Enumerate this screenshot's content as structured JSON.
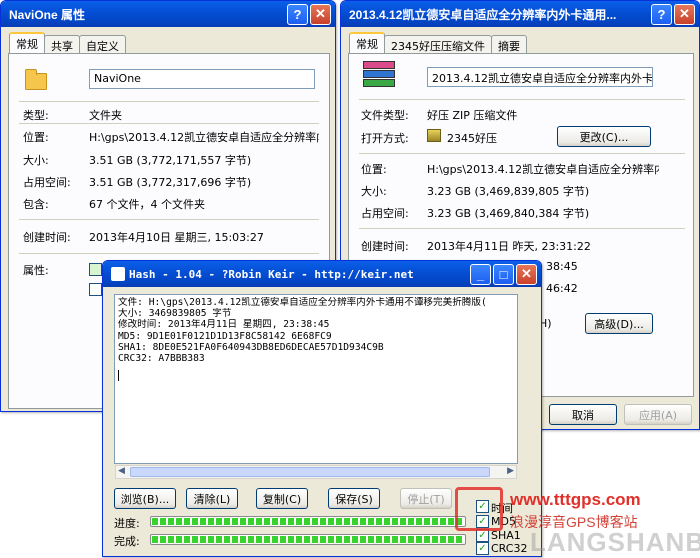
{
  "win1": {
    "title": "NaviOne 属性",
    "tabs": [
      "常规",
      "共享",
      "自定义"
    ],
    "name_value": "NaviOne",
    "rows": [
      {
        "label": "类型:",
        "value": "文件夹"
      },
      {
        "label": "位置:",
        "value": "H:\\gps\\2013.4.12凯立德安卓自适应全分辨率内"
      },
      {
        "label": "大小:",
        "value": "3.51 GB (3,772,171,557 字节)"
      },
      {
        "label": "占用空间:",
        "value": "3.51 GB (3,772,317,696 字节)"
      },
      {
        "label": "包含:",
        "value": "67 个文件，4 个文件夹"
      },
      {
        "label": "创建时间:",
        "value": "2013年4月10日 星期三, 15:03:27"
      },
      {
        "label": "属性:",
        "value": ""
      }
    ]
  },
  "win2": {
    "title": "2013.4.12凯立德安卓自适应全分辨率内外卡通用...",
    "tabs": [
      "常规",
      "2345好压压缩文件",
      "摘要"
    ],
    "name_value": "2013.4.12凯立德安卓自适应全分辨率内外卡通",
    "type_label": "文件类型:",
    "type_value": "好压 ZIP 压缩文件",
    "open_label": "打开方式:",
    "open_value": "2345好压",
    "change_button": "更改(C)...",
    "rows": [
      {
        "label": "位置:",
        "value": "H:\\gps\\2013.4.12凯立德安卓自适应全分辨率内"
      },
      {
        "label": "大小:",
        "value": "3.23 GB (3,469,839,805 字节)"
      },
      {
        "label": "占用空间:",
        "value": "3.23 GB (3,469,840,384 字节)"
      },
      {
        "label": "创建时间:",
        "value": "2013年4月11日 昨天, 23:31:22"
      }
    ],
    "partial1": "38:45",
    "partial2": "46:42",
    "partial3": "H)",
    "advanced_button": "高级(D)...",
    "cancel_button": "取消",
    "apply_button": "应用(A)"
  },
  "hash": {
    "title": "Hash - 1.04 - ?Robin Keir - http://keir.net",
    "lines": [
      "文件: H:\\gps\\2013.4.12凯立德安卓自适应全分辨率内外卡通用不谭移完美折腾版(",
      "大小: 3469839805 字节",
      "修改时间: 2013年4月11日 星期四, 23:38:45",
      "MD5: 9D1E01F0121D1D13F8C58142 6E68FC9",
      "SHA1: 8DE0E521FA0F640943DB8ED6DECAE57D1D934C9B",
      "CRC32: A7BBB383"
    ],
    "buttons": {
      "browse": "浏览(B)...",
      "clear": "清除(L)",
      "copy": "复制(C)",
      "save": "保存(S)",
      "stop": "停止(T)"
    },
    "progress_label": "进度:",
    "done_label": "完成:",
    "progress_value": 1.0,
    "done_value": 1.0,
    "checks": [
      "MD5",
      "SHA1",
      "CRC32"
    ],
    "check_partial": [
      "时间",
      "MD"
    ]
  },
  "watermark": {
    "url": "www.tttgps.com",
    "cn": "浪漫淳音GPS博客站",
    "en": "LANGSHANBBS"
  }
}
